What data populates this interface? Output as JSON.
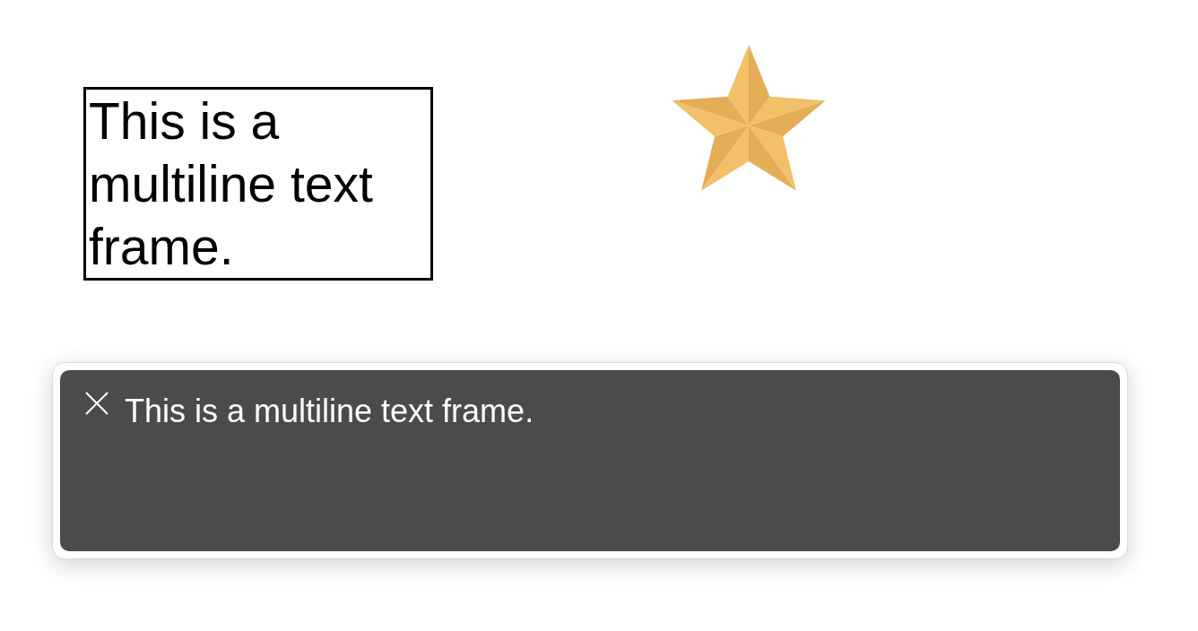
{
  "text_frame": {
    "text": "This is a multiline text frame."
  },
  "caption": {
    "text": "This is a multiline text frame."
  }
}
